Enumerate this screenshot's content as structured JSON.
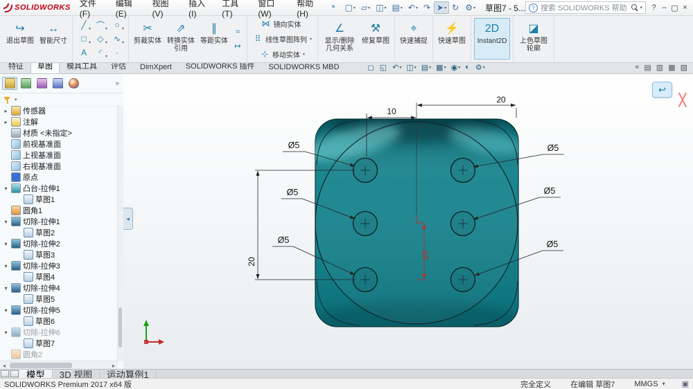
{
  "colors": {
    "logo_red": "#c20017",
    "dice_teal": "#11818b",
    "dimension_red": "#c62828",
    "highlight_blue": "#d8ecf8"
  },
  "titlebar": {
    "logo_text": "SOLIDWORKS",
    "menus": [
      {
        "label": "文件(F)"
      },
      {
        "label": "编辑(E)"
      },
      {
        "label": "视图(V)"
      },
      {
        "label": "插入(I)"
      },
      {
        "label": "工具(T)"
      },
      {
        "label": "窗口(W)"
      },
      {
        "label": "帮助(H)"
      }
    ],
    "pin_glyph": "*",
    "tools": [
      {
        "n": "new-document-icon",
        "g": "▢",
        "dd": "▾"
      },
      {
        "n": "open-icon",
        "g": "▱",
        "dd": "▾"
      },
      {
        "n": "save-icon",
        "g": "◫",
        "dd": "▾"
      },
      {
        "n": "print-icon",
        "g": "▤",
        "dd": "▾"
      },
      {
        "n": "undo-icon",
        "g": "↶",
        "dd": "▾"
      },
      {
        "n": "redo-icon",
        "g": "↷",
        "dd": ""
      },
      {
        "n": "select-icon",
        "g": "➤",
        "dd": "▾",
        "cls": "pressed"
      },
      {
        "n": "rebuild-icon",
        "g": "↻",
        "dd": ""
      },
      {
        "n": "options-icon",
        "g": "⚙",
        "dd": "▾"
      }
    ],
    "doc_title": "草图7 - 5...",
    "search": {
      "help_icon": "?",
      "placeholder": "搜索 SOLIDWORKS 帮助",
      "caret": "▾"
    },
    "window": {
      "help": "?",
      "min": "–",
      "max": "▢",
      "close": "×"
    }
  },
  "ribbon": {
    "exit_sketch": "退出草图",
    "smart_dimension": "智能尺寸",
    "icons": {
      "exit": "↪",
      "smart": "↔",
      "trim": "✂",
      "convert": "⇗",
      "offset": "∥",
      "relations": "∠",
      "repair": "⚒",
      "snaps": "⌖",
      "rapid": "⚡",
      "instant": "2D",
      "shaded": "◪"
    },
    "sketch_tools": [
      {
        "n": "line-tool-icon",
        "g": "╱",
        "dd": "▾"
      },
      {
        "n": "arc-tool-icon",
        "g": "⌒",
        "dd": "▾"
      },
      {
        "n": "circle-tool-icon",
        "g": "○",
        "dd": "▾"
      },
      {
        "n": "rectangle-tool-icon",
        "g": "□",
        "dd": "▾"
      },
      {
        "n": "polygon-tool-icon",
        "g": "◇",
        "dd": "▾"
      },
      {
        "n": "spline-tool-icon",
        "g": "∿",
        "dd": "▾"
      },
      {
        "n": "text-tool-icon",
        "g": "A",
        "dd": ""
      },
      {
        "n": "fillet-tool-icon",
        "g": "◜",
        "dd": "▾"
      },
      {
        "n": "point-tool-icon",
        "g": "·",
        "dd": ""
      }
    ],
    "minis": [
      {
        "n": "surface-offset-icon",
        "g": "≈"
      },
      {
        "n": "stretch-entities-icon",
        "g": "↦"
      }
    ],
    "trim_entities": "剪裁实体",
    "convert_entities": "转换实体引用",
    "offset_entities": "等距实体",
    "col_tools": [
      {
        "n": "mirror-entities-button",
        "g": "⋈",
        "label": "镜向实体",
        "dd": ""
      },
      {
        "n": "linear-pattern-button",
        "g": "⠿",
        "label": "线性草图阵列",
        "dd": "▾"
      },
      {
        "n": "move-entities-button",
        "g": "⊹",
        "label": "移动实体",
        "dd": "▾"
      }
    ],
    "display_relations": "显示/删除几何关系",
    "repair_sketch": "修复草图",
    "quick_snaps": "快速捕捉",
    "rapid_sketch": "快速草图",
    "instant2d": "Instant2D",
    "shaded_contours": "上色草图轮廓"
  },
  "tabs": {
    "items": [
      {
        "label": "特征"
      },
      {
        "label": "草图",
        "cls": "active"
      },
      {
        "label": "模具工具"
      },
      {
        "label": "评估"
      },
      {
        "label": "DimXpert"
      },
      {
        "label": "SOLIDWORKS 插件"
      },
      {
        "label": "SOLIDWORKS MBD"
      }
    ]
  },
  "headsup": {
    "items": [
      {
        "n": "zoom-to-fit-button",
        "g": "◻",
        "dd": ""
      },
      {
        "n": "zoom-to-area-button",
        "g": "◱",
        "dd": ""
      },
      {
        "n": "previous-view-button",
        "g": "↶",
        "dd": "▾"
      },
      {
        "n": "section-view-button",
        "g": "◫",
        "dd": "▾"
      },
      {
        "n": "view-orientation-button",
        "g": "▤",
        "dd": "▾"
      },
      {
        "n": "display-style-button",
        "g": "▦",
        "dd": "▾"
      },
      {
        "n": "hide-show-items-button",
        "g": "◉",
        "dd": "▾"
      },
      {
        "n": "edit-appearance-button",
        "g": "◐",
        "dd": ""
      },
      {
        "n": "view-settings-button",
        "g": "⚙",
        "dd": "▾"
      }
    ]
  },
  "taskpane": {
    "items": [
      {
        "n": "collapse-taskpane-icon",
        "g": "«"
      },
      {
        "n": "resources-icon",
        "g": "▤"
      },
      {
        "n": "design-library-icon",
        "g": "▥"
      },
      {
        "n": "file-explorer-icon",
        "g": "▦"
      },
      {
        "n": "view-palette-icon",
        "g": "▧"
      }
    ]
  },
  "panel": {
    "tabs": [
      {
        "n": "featuremanager-tab",
        "cls": "fm active"
      },
      {
        "n": "propertymanager-tab",
        "cls": "pm"
      },
      {
        "n": "configurationmanager-tab",
        "cls": "cm"
      },
      {
        "n": "dimxpertmanager-tab",
        "cls": "dx"
      },
      {
        "n": "displaymanager-tab",
        "cls": "dm"
      }
    ],
    "chevron": "»",
    "flyout_glyph": "◂",
    "tree": [
      {
        "a": "▸",
        "icon": "sensors",
        "label": "传感器"
      },
      {
        "a": "▸",
        "icon": "annotations",
        "label": "注解"
      },
      {
        "a": "",
        "icon": "material",
        "label": "材质 <未指定>"
      },
      {
        "a": "",
        "icon": "plane",
        "label": "前视基准面"
      },
      {
        "a": "",
        "icon": "plane",
        "label": "上视基准面"
      },
      {
        "a": "",
        "icon": "plane",
        "label": "右视基准面"
      },
      {
        "a": "",
        "icon": "origin",
        "label": "原点"
      },
      {
        "a": "▾",
        "icon": "boss",
        "label": "凸台-拉伸1"
      },
      {
        "a": "",
        "icon": "sketch",
        "label": "草图1",
        "lvl": 1
      },
      {
        "a": "",
        "icon": "fillet",
        "label": "圆角1"
      },
      {
        "a": "▾",
        "icon": "cut",
        "label": "切除-拉伸1"
      },
      {
        "a": "",
        "icon": "sketch",
        "label": "草图2",
        "lvl": 1
      },
      {
        "a": "▾",
        "icon": "cut",
        "label": "切除-拉伸2"
      },
      {
        "a": "",
        "icon": "sketch",
        "label": "草图3",
        "lvl": 1
      },
      {
        "a": "▾",
        "icon": "cut",
        "label": "切除-拉伸3"
      },
      {
        "a": "",
        "icon": "sketch",
        "label": "草图4",
        "lvl": 1
      },
      {
        "a": "▾",
        "icon": "cut",
        "label": "切除-拉伸4"
      },
      {
        "a": "",
        "icon": "sketch",
        "label": "草图5",
        "lvl": 1
      },
      {
        "a": "▾",
        "icon": "cut",
        "label": "切除-拉伸5"
      },
      {
        "a": "",
        "icon": "sketch",
        "label": "草图6",
        "lvl": 1
      },
      {
        "a": "▾",
        "icon": "cut",
        "label": "切除-拉伸6",
        "cls": "dim"
      },
      {
        "a": "",
        "icon": "sketch",
        "label": "草图7",
        "lvl": 1
      },
      {
        "a": "",
        "icon": "fillet",
        "label": "圆角2",
        "cls": "dim"
      }
    ]
  },
  "viewport": {
    "dims": {
      "top_small": "10",
      "top_large": "20",
      "left": "20",
      "middle": "10",
      "dia": "Ø5"
    },
    "confirm": {
      "exit_glyph": "↩",
      "cancel_glyph": "╳"
    }
  },
  "bottom_tabs": {
    "items": [
      {
        "label": "模型",
        "cls": "active"
      },
      {
        "label": "3D 视图"
      },
      {
        "label": "运动算例1"
      }
    ]
  },
  "statusbar": {
    "product": "SOLIDWORKS Premium 2017 x64 版",
    "defined": "完全定义",
    "editing": "在编辑 草图7",
    "units": "MMGS",
    "units_caret": "▾",
    "pane_icon": "▣"
  }
}
